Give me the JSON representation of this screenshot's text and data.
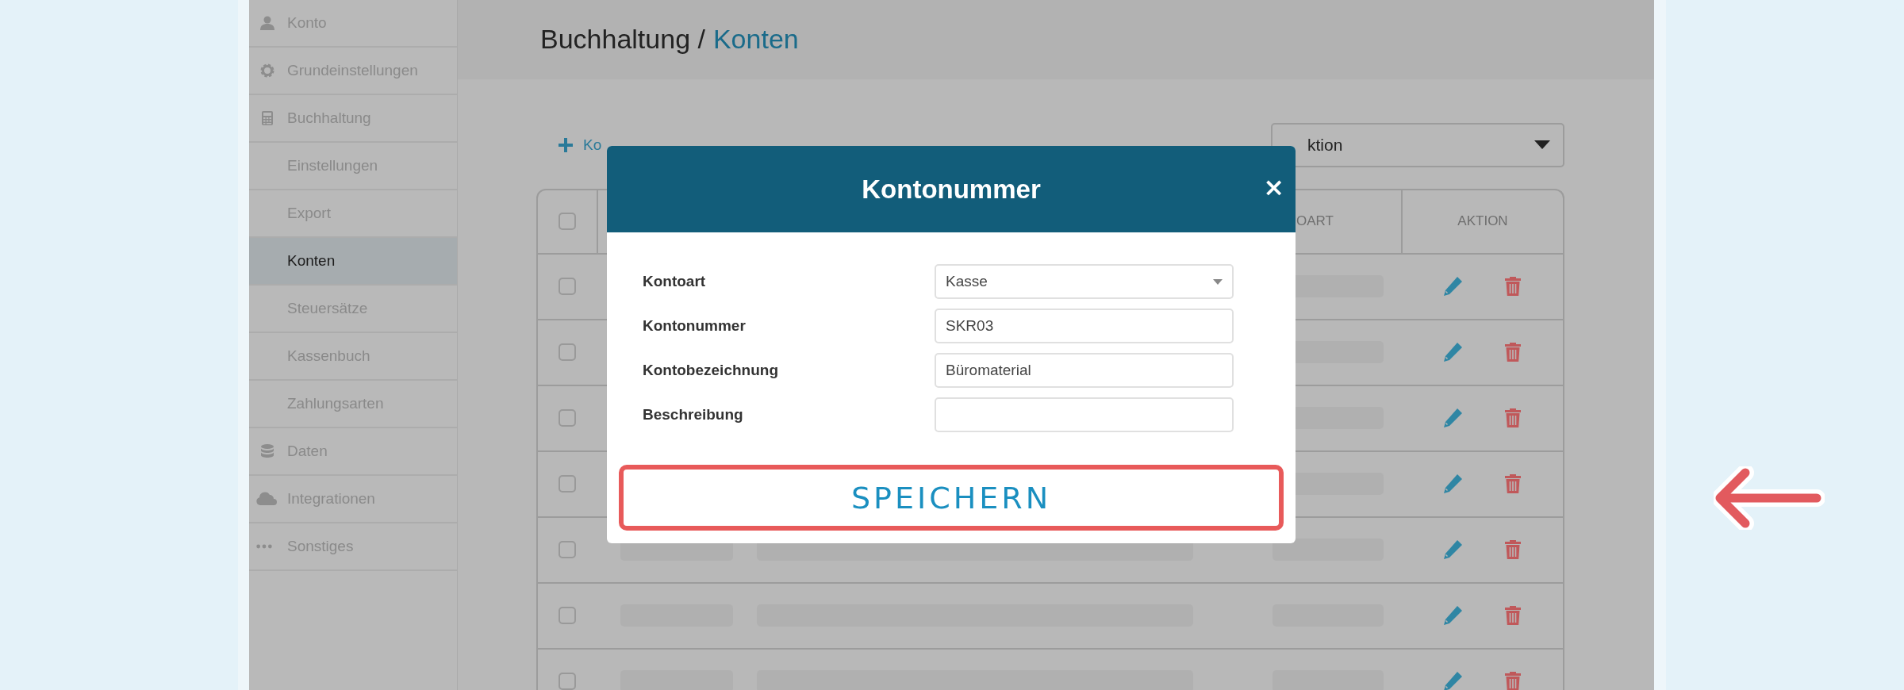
{
  "sidebar": {
    "items": [
      {
        "label": "Konto",
        "kind": "section",
        "selected": false
      },
      {
        "label": "Grundeinstellungen",
        "kind": "section",
        "selected": false
      },
      {
        "label": "Buchhaltung",
        "kind": "section",
        "selected": false
      },
      {
        "label": "Einstellungen",
        "kind": "subitem",
        "selected": false
      },
      {
        "label": "Export",
        "kind": "subitem",
        "selected": false
      },
      {
        "label": "Konten",
        "kind": "subitem",
        "selected": true
      },
      {
        "label": "Steuersätze",
        "kind": "subitem",
        "selected": false
      },
      {
        "label": "Kassenbuch",
        "kind": "subitem",
        "selected": false
      },
      {
        "label": "Zahlungsarten",
        "kind": "subitem",
        "selected": false
      },
      {
        "label": "Daten",
        "kind": "section",
        "selected": false
      },
      {
        "label": "Integrationen",
        "kind": "section",
        "selected": false
      },
      {
        "label": "Sonstiges",
        "kind": "section",
        "selected": false
      }
    ]
  },
  "breadcrumb": {
    "parent": "Buchhaltung /",
    "current": "Konten"
  },
  "toolbar": {
    "add_link": "Ko",
    "action_select": "ktion"
  },
  "table": {
    "select_all_checked": false,
    "columns": [
      "OART",
      "AKTION"
    ],
    "rows": [
      {
        "checked": false
      },
      {
        "checked": false
      },
      {
        "checked": false
      },
      {
        "checked": false
      },
      {
        "checked": false
      },
      {
        "checked": false
      },
      {
        "checked": false
      }
    ]
  },
  "modal": {
    "title": "Kontonummer",
    "close": "×",
    "fields": [
      {
        "label": "Kontoart",
        "kind": "select",
        "value": "Kasse"
      },
      {
        "label": "Kontonummer",
        "kind": "text",
        "value": "SKR03"
      },
      {
        "label": "Kontobezeichnung",
        "kind": "text",
        "value": "Büromaterial"
      },
      {
        "label": "Beschreibung",
        "kind": "text"
      }
    ],
    "save_button": "SPEICHERN"
  }
}
